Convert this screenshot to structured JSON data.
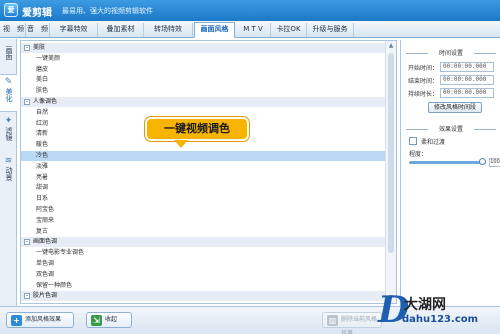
{
  "titlebar": {
    "logo_text": "爱",
    "title": "爱剪辑",
    "subtitle": "最易用、强大的视频剪辑软件"
  },
  "tabs": [
    {
      "label": "视　频"
    },
    {
      "label": "音　频"
    },
    {
      "label": "字幕特效"
    },
    {
      "label": "叠加素材"
    },
    {
      "label": "转场特效"
    },
    {
      "label": "画面风格",
      "active": true
    },
    {
      "label": "M T V"
    },
    {
      "label": "卡拉OK"
    },
    {
      "label": "升级与服务"
    }
  ],
  "sidetabs": [
    {
      "label": "画面",
      "icon": "frame-icon"
    },
    {
      "label": "美化",
      "icon": "magic-wand-icon",
      "active": true
    },
    {
      "label": "滤镜",
      "icon": "filter-icon"
    },
    {
      "label": "动景",
      "icon": "motion-icon"
    }
  ],
  "list": {
    "selected": "冷色",
    "rows": [
      {
        "type": "group",
        "label": "美肤",
        "toggle": "-"
      },
      {
        "type": "item",
        "label": "一键美颜"
      },
      {
        "type": "item",
        "label": "磨皮"
      },
      {
        "type": "item",
        "label": "美白"
      },
      {
        "type": "item",
        "label": "肤色"
      },
      {
        "type": "group",
        "label": "人像调色",
        "toggle": "-"
      },
      {
        "type": "item",
        "label": "自然"
      },
      {
        "type": "item",
        "label": "红润"
      },
      {
        "type": "item",
        "label": "清新"
      },
      {
        "type": "item",
        "label": "暖色"
      },
      {
        "type": "item",
        "label": "冷色"
      },
      {
        "type": "item",
        "label": "淡雅"
      },
      {
        "type": "item",
        "label": "亮暑"
      },
      {
        "type": "item",
        "label": "甜调"
      },
      {
        "type": "item",
        "label": "日系"
      },
      {
        "type": "item",
        "label": "阿宝色"
      },
      {
        "type": "item",
        "label": "宝丽来"
      },
      {
        "type": "item",
        "label": "复古"
      },
      {
        "type": "group",
        "label": "画面色调",
        "toggle": "-"
      },
      {
        "type": "item",
        "label": "一键电影专业调色"
      },
      {
        "type": "item",
        "label": "单色调"
      },
      {
        "type": "item",
        "label": "双色调"
      },
      {
        "type": "item",
        "label": "保留一种颜色"
      },
      {
        "type": "group",
        "label": "胶片色调",
        "toggle": "-"
      }
    ]
  },
  "callout": {
    "text": "一键视频调色"
  },
  "right_panel": {
    "time_section": "时间设置",
    "fields": [
      {
        "label": "开始时间：",
        "value": "00:00:00.000"
      },
      {
        "label": "结束时间：",
        "value": "00:00:00.000"
      },
      {
        "label": "持续时长：",
        "value": "00:00:00.000"
      }
    ],
    "modify_button": "修改风格时间段",
    "effect_section": "效果设置",
    "checkbox_label": "柔和过渡",
    "degree_label": "程度：",
    "degree_value": "100",
    "degree_fraction": 1.0
  },
  "bottom": {
    "add_button": "添加风格效果",
    "collapse_button": "收起",
    "delete_button": "删除当前风格效果"
  },
  "watermark": {
    "letter": "D",
    "brand": "大湖网",
    "url": "dahu123.com"
  },
  "colors": {
    "accent": "#1b79c8",
    "callout": "#f7b400",
    "selected_row": "#b8d8f4"
  }
}
